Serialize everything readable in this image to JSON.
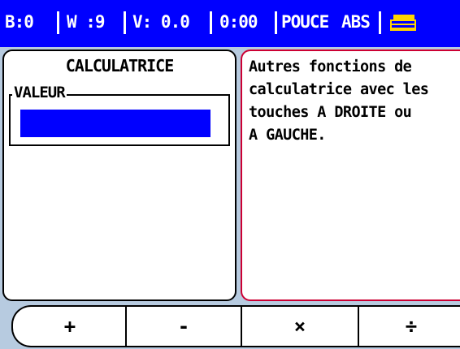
{
  "status": {
    "b": "B:0",
    "w": "W :9",
    "v": "V: 0.0",
    "time": "0:00",
    "units": "POUCE",
    "mode": "ABS",
    "icon": "printer-icon"
  },
  "calculator": {
    "title": "CALCULATRICE",
    "value_label": "VALEUR",
    "value": ""
  },
  "help": {
    "text": "Autres fonctions de\ncalculatrice avec les\ntouches A DROITE ou\nA GAUCHE."
  },
  "softkeys": [
    "+",
    "-",
    "×",
    "÷"
  ],
  "colors": {
    "statusbar": "#0000ff",
    "background": "#b7cbe0",
    "input": "#0000ff",
    "help_border": "#cc0033"
  }
}
